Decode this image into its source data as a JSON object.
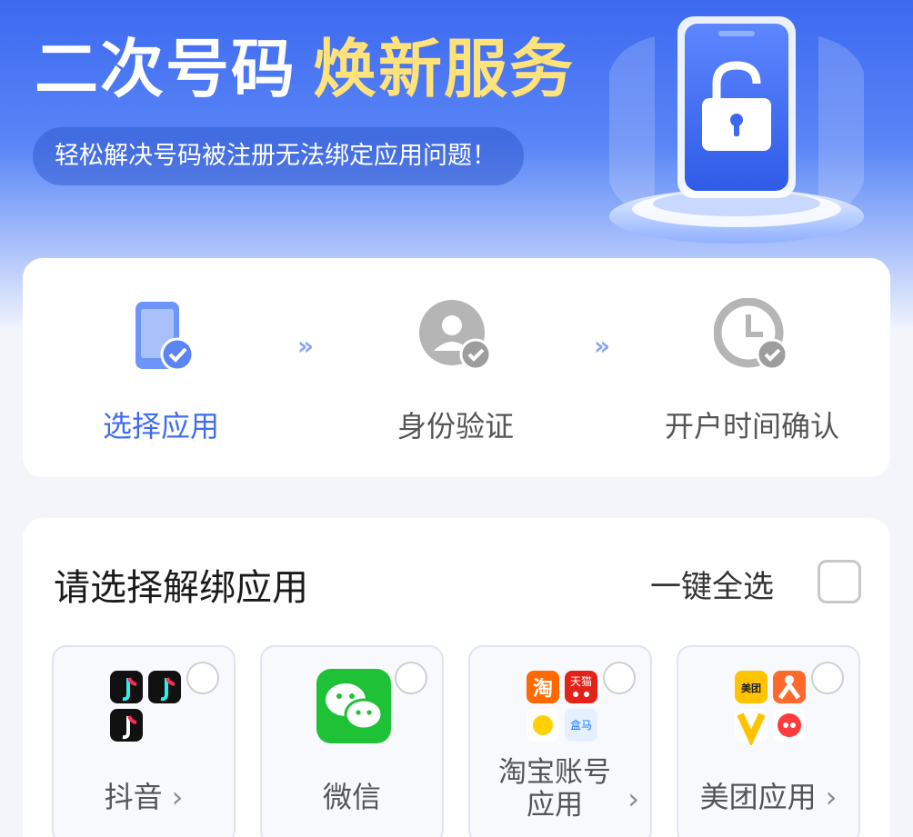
{
  "hero": {
    "title_part1": "二次号码",
    "title_part2": "焕新服务",
    "subtitle": "轻松解决号码被注册无法绑定应用问题！",
    "accent_color": "#ffe27a"
  },
  "steps": [
    {
      "label": "选择应用",
      "icon": "phone-check-icon",
      "active": true
    },
    {
      "label": "身份验证",
      "icon": "user-check-icon",
      "active": false
    },
    {
      "label": "开户时间确认",
      "icon": "clock-check-icon",
      "active": false
    }
  ],
  "step_arrow": "»",
  "apps_section": {
    "title": "请选择解绑应用",
    "select_all_label": "一键全选",
    "chevron": "›",
    "apps": [
      {
        "name": "抖音",
        "icon": "douyin-apps-icon"
      },
      {
        "name": "微信",
        "icon": "wechat-icon"
      },
      {
        "name": "淘宝账号应用",
        "icon": "taobao-apps-icon",
        "sub_labels": [
          "淘",
          "天猫",
          "盒马"
        ]
      },
      {
        "name": "美团应用",
        "icon": "meituan-apps-icon",
        "sub_labels": [
          "美团"
        ]
      }
    ]
  },
  "colors": {
    "brand_blue": "#3f6df0",
    "hero_top": "#3c69f0"
  }
}
